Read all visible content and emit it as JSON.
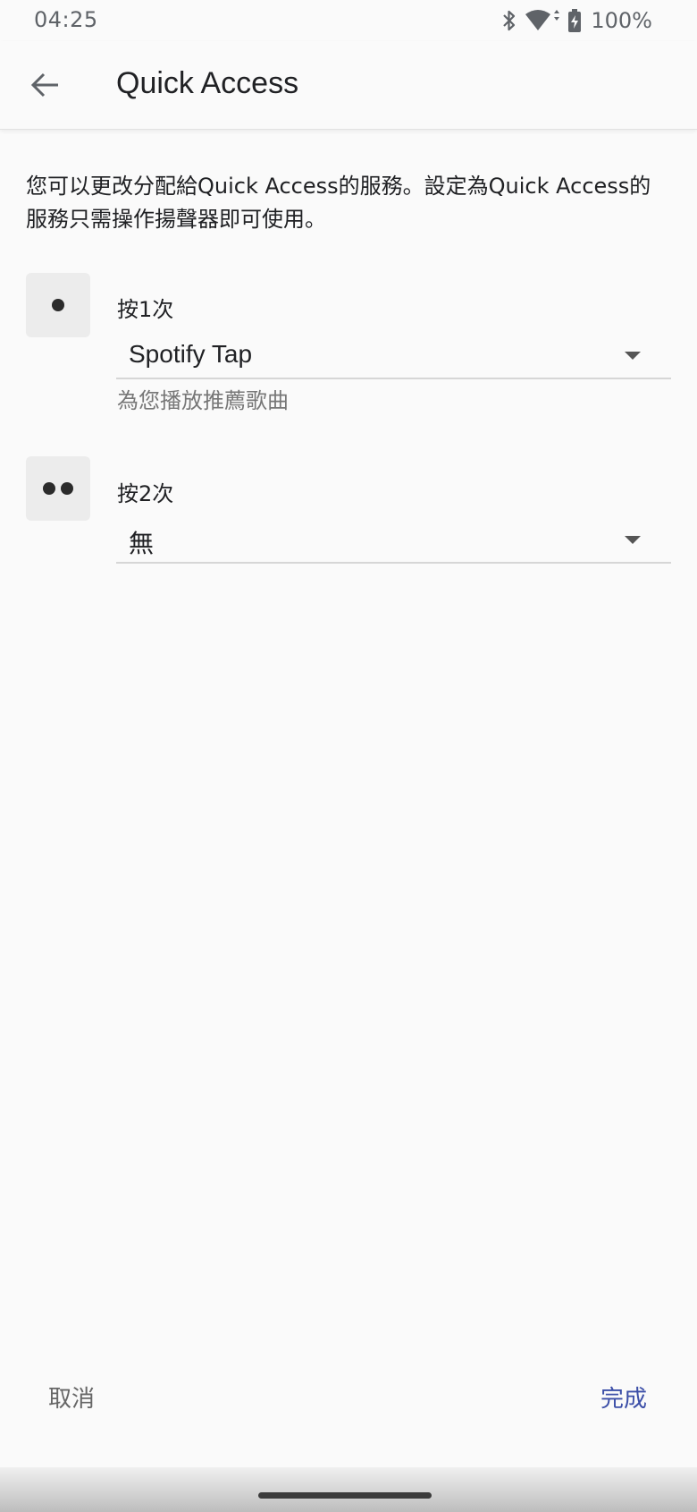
{
  "status_bar": {
    "time": "04:25",
    "battery_percent": "100%",
    "icons": [
      "bluetooth-icon",
      "wifi-icon",
      "battery-charging-icon"
    ]
  },
  "app_bar": {
    "title": "Quick Access",
    "back_icon": "arrow-back-icon"
  },
  "description": "您可以更改分配給Quick Access的服務。設定為Quick Access的服務只需操作揚聲器即可使用。",
  "rows": [
    {
      "label": "按1次",
      "icon": "single-dot-icon",
      "selected_value": "Spotify Tap",
      "subtext": "為您播放推薦歌曲"
    },
    {
      "label": "按2次",
      "icon": "double-dot-icon",
      "selected_value": "無"
    }
  ],
  "footer": {
    "cancel_label": "取消",
    "done_label": "完成"
  },
  "colors": {
    "background": "#fafafa",
    "accent": "#3c4fa8",
    "text_primary": "#202124",
    "text_secondary": "#777777"
  }
}
